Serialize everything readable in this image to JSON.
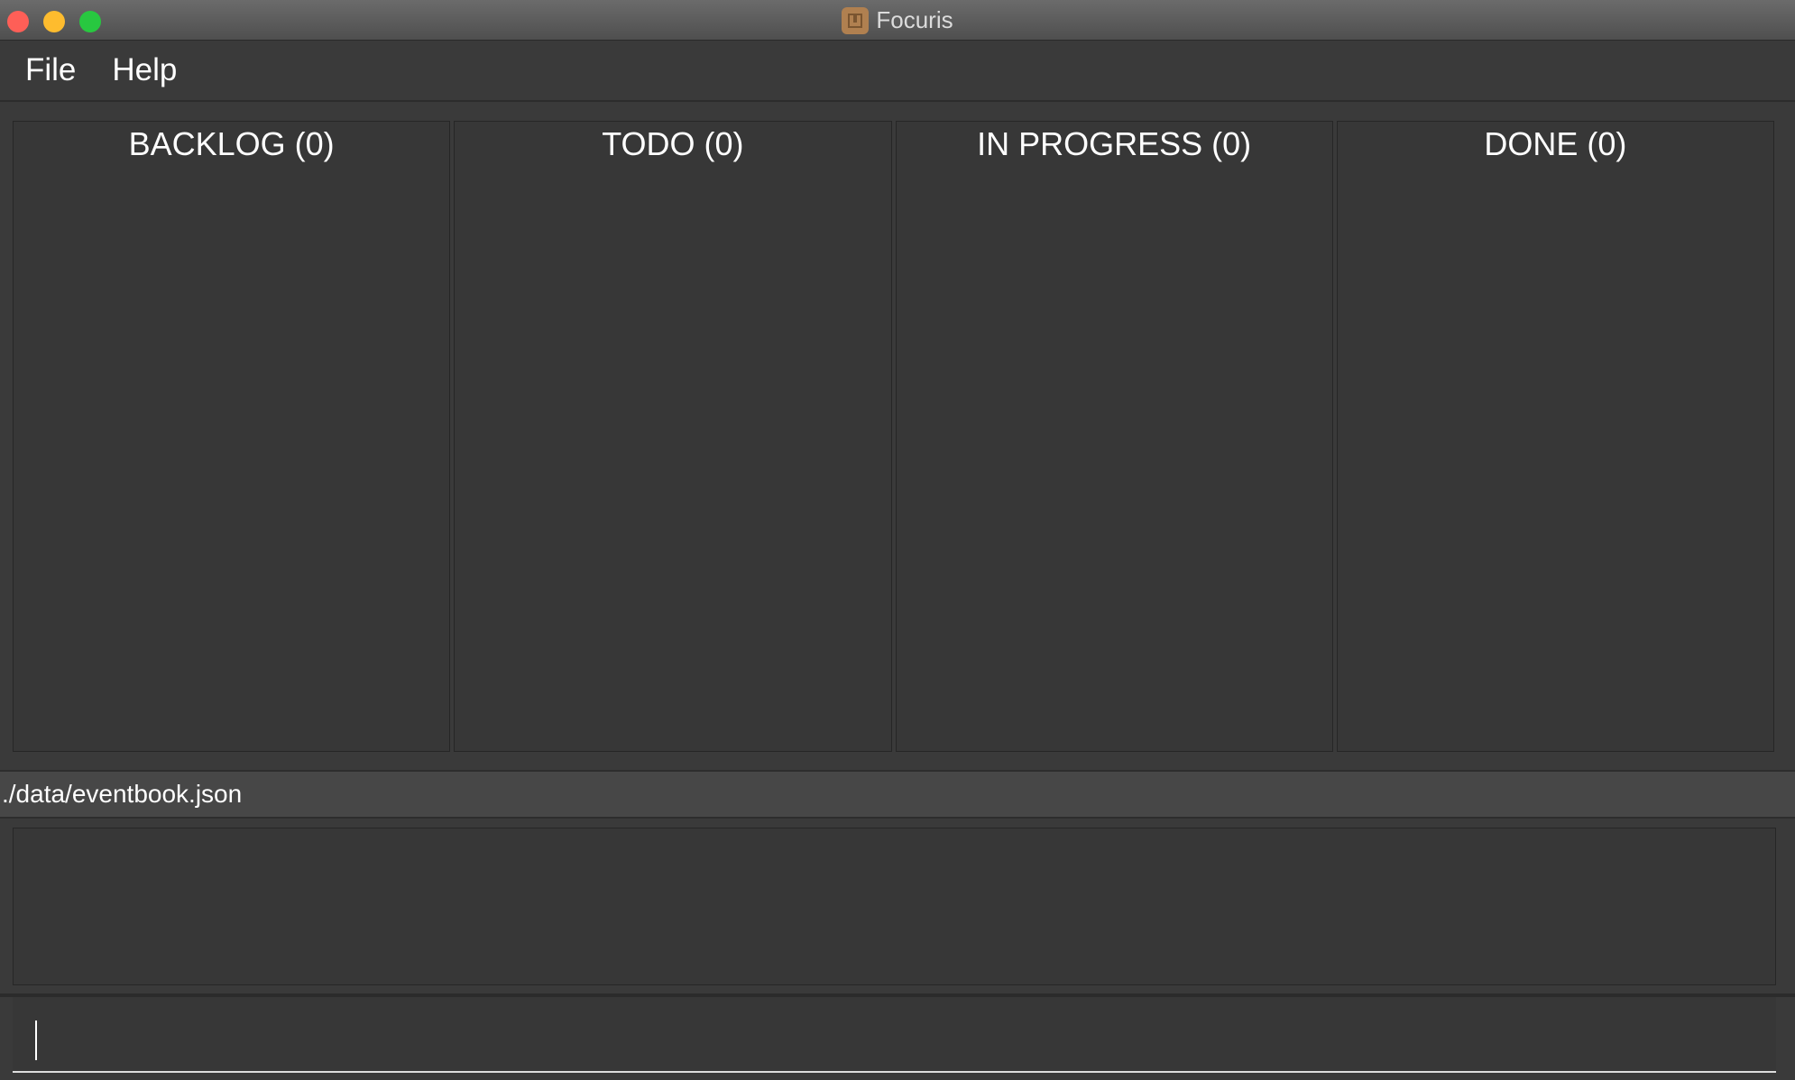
{
  "window": {
    "title": "Focuris",
    "app_icon": "focuris-app-icon"
  },
  "menu": {
    "items": [
      {
        "label": "File"
      },
      {
        "label": "Help"
      }
    ]
  },
  "board": {
    "columns": [
      {
        "title": "BACKLOG (0)",
        "count": 0
      },
      {
        "title": "TODO (0)",
        "count": 0
      },
      {
        "title": "IN PROGRESS (0)",
        "count": 0
      },
      {
        "title": "DONE (0)",
        "count": 0
      }
    ]
  },
  "status": {
    "file_path": "./data/eventbook.json"
  },
  "result": {
    "text": ""
  },
  "command": {
    "value": "",
    "placeholder": ""
  },
  "colors": {
    "background": "#3a3a3a",
    "close": "#fe5f57",
    "minimize": "#febc2e",
    "zoom": "#28c840",
    "text": "#ffffff"
  }
}
